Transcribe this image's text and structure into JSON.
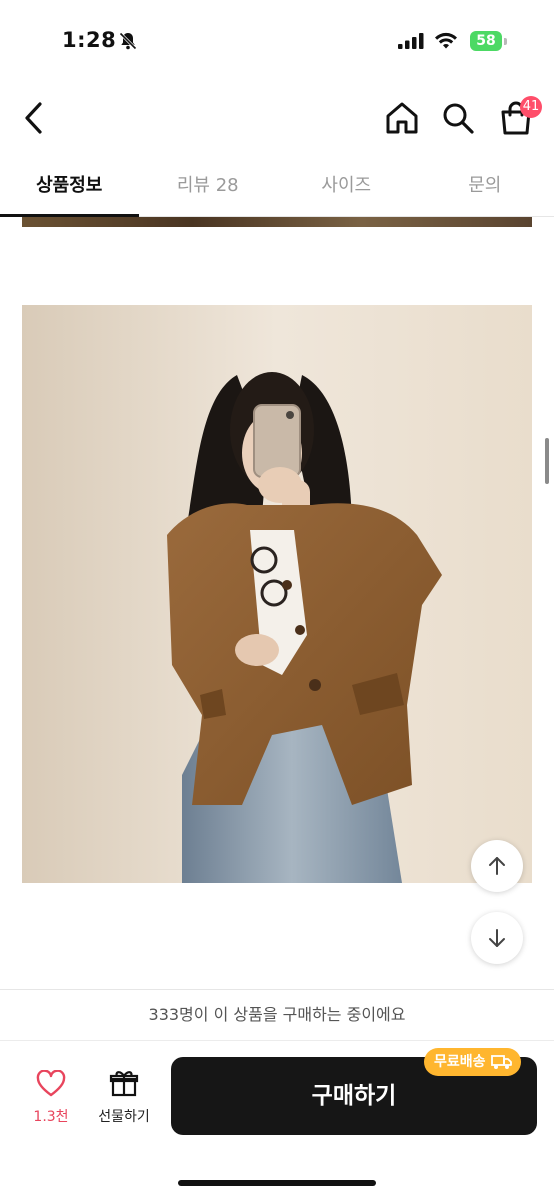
{
  "status_bar": {
    "time": "1:28",
    "battery": "58"
  },
  "header": {
    "cart_badge": "41"
  },
  "tabs": [
    {
      "label": "상품정보",
      "active": true
    },
    {
      "label": "리뷰 28",
      "active": false
    },
    {
      "label": "사이즈",
      "active": false
    },
    {
      "label": "문의",
      "active": false
    }
  ],
  "purchase_notice": "333명이 이 상품을 구매하는 중이에요",
  "actions": {
    "like_count": "1.3천",
    "gift_label": "선물하기",
    "buy_label": "구매하기",
    "free_shipping_badge": "무료배송"
  },
  "colors": {
    "accent": "#ff4e6a",
    "buy_button": "#161616",
    "free_shipping": "#ffb62f",
    "like": "#e8455d"
  },
  "icons": [
    "bell-slash-icon",
    "signal-icon",
    "wifi-icon",
    "battery-icon",
    "back-chevron-icon",
    "home-icon",
    "search-icon",
    "cart-icon",
    "arrow-up-icon",
    "arrow-down-icon",
    "heart-icon",
    "gift-icon",
    "truck-icon"
  ]
}
